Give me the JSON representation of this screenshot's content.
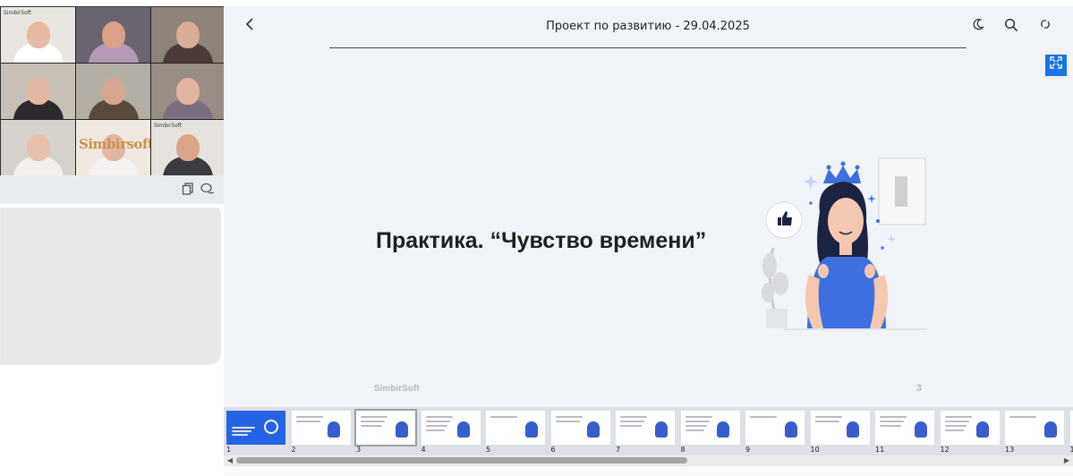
{
  "header": {
    "title": "Проект по развитию - 29.04.2025",
    "back_icon": "chevron-left-icon",
    "actions": [
      "theme-moon-icon",
      "search-icon",
      "sync-icon"
    ],
    "fullscreen_icon": "expand-icon"
  },
  "slide": {
    "heading": "Практика. “Чувство времени”",
    "logo": "SimbirSoft",
    "page_number": "3"
  },
  "video_panel": {
    "tiles": [
      {
        "tag": "SimbirSoft",
        "bg": "#e9e6e1",
        "skin": "#e7b9a2",
        "shirt": "#ffffff"
      },
      {
        "tag": "",
        "bg": "#6a6470",
        "skin": "#d9a08a",
        "shirt": "#b49ab4"
      },
      {
        "tag": "",
        "bg": "#8d8379",
        "skin": "#d9ad96",
        "shirt": "#4a3b38"
      },
      {
        "tag": "",
        "bg": "#c7c0b7",
        "skin": "#e3b8a3",
        "shirt": "#2c2a2c"
      },
      {
        "tag": "",
        "bg": "#b3aea5",
        "skin": "#d8a590",
        "shirt": "#5a4a3d"
      },
      {
        "tag": "",
        "bg": "#978d85",
        "skin": "#e0b49e",
        "shirt": "#7a6f80"
      },
      {
        "tag": "",
        "bg": "#d5d1cc",
        "skin": "#e6c0ac",
        "shirt": "#f2efec"
      },
      {
        "tag": "Simbirsoft",
        "bg": "#efe9e2",
        "skin": "#e2b7a1",
        "shirt": "#f4f2f0"
      },
      {
        "tag": "SimbirSoft",
        "bg": "#e6e3df",
        "skin": "#d9a589",
        "shirt": "#3b3b40"
      }
    ],
    "toolbar_icons": [
      "copy-icon",
      "chat-icon"
    ]
  },
  "thumbnails": [
    {
      "number": "1"
    },
    {
      "number": "2"
    },
    {
      "number": "3"
    },
    {
      "number": "4"
    },
    {
      "number": "5"
    },
    {
      "number": "6"
    },
    {
      "number": "7"
    },
    {
      "number": "8"
    },
    {
      "number": "9"
    },
    {
      "number": "10"
    },
    {
      "number": "11"
    },
    {
      "number": "12"
    },
    {
      "number": "13"
    },
    {
      "number": "1"
    }
  ],
  "active_thumbnail": 3,
  "colors": {
    "accent": "#1a73e8",
    "slide_blue": "#2463e6",
    "illustration_blue": "#3d6fe0",
    "hair": "#1c2340"
  }
}
